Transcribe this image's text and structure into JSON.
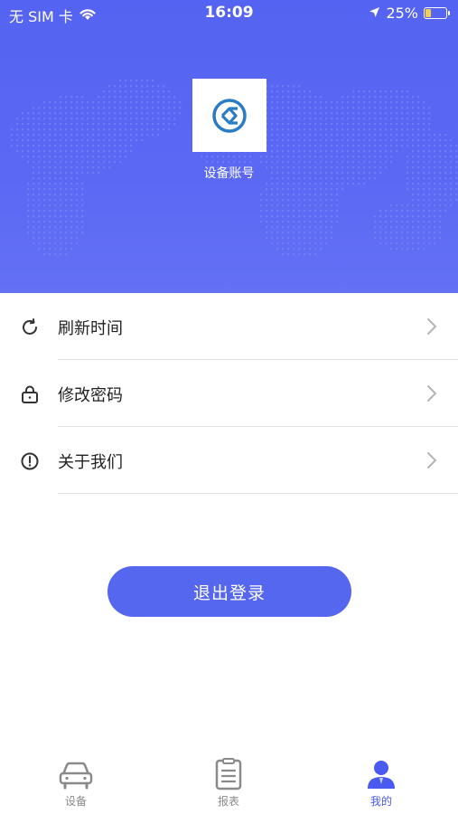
{
  "status_bar": {
    "carrier": "无 SIM 卡",
    "time": "16:09",
    "battery": "25%",
    "battery_level": 0.25
  },
  "header": {
    "account_label": "设备账号"
  },
  "menu": {
    "items": [
      {
        "label": "刷新时间",
        "icon": "refresh-icon"
      },
      {
        "label": "修改密码",
        "icon": "lock-icon"
      },
      {
        "label": "关于我们",
        "icon": "info-icon"
      }
    ]
  },
  "logout": {
    "label": "退出登录"
  },
  "tabbar": {
    "items": [
      {
        "label": "设备",
        "icon": "car-icon",
        "active": false
      },
      {
        "label": "报表",
        "icon": "report-icon",
        "active": false
      },
      {
        "label": "我的",
        "icon": "user-icon",
        "active": true
      }
    ]
  },
  "colors": {
    "primary": "#5566ef",
    "header_bg": "#5a68f4",
    "tab_active": "#4a5af0",
    "tab_inactive": "#8a8a8a",
    "battery_fill": "#f3d04a"
  }
}
